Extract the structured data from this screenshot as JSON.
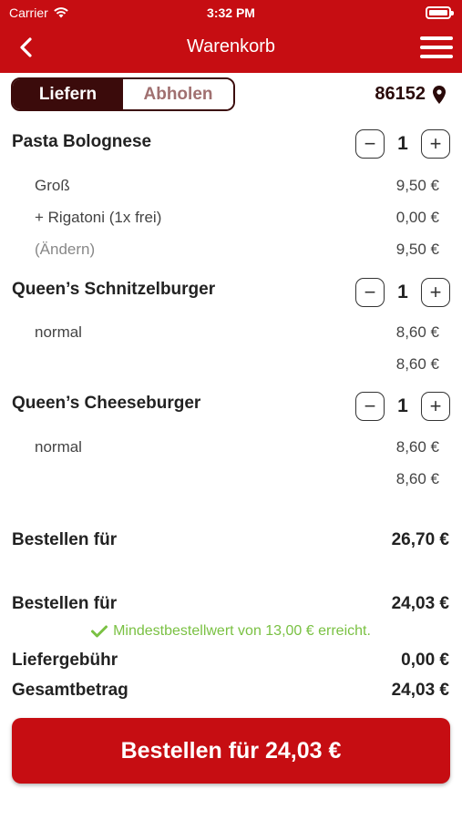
{
  "status_bar": {
    "carrier": "Carrier",
    "time": "3:32 PM"
  },
  "header": {
    "title": "Warenkorb"
  },
  "mode_toggle": {
    "deliver": "Liefern",
    "pickup": "Abholen"
  },
  "location": {
    "zip": "86152"
  },
  "items": [
    {
      "name": "Pasta Bolognese",
      "quantity": "1",
      "lines": [
        {
          "label": "Groß",
          "price": "9,50 €"
        },
        {
          "label": "+ Rigatoni (1x frei)",
          "price": "0,00 €"
        },
        {
          "label": "(Ändern)",
          "price": "9,50 €"
        }
      ]
    },
    {
      "name": "Queen’s Schnitzelburger",
      "quantity": "1",
      "lines": [
        {
          "label": "normal",
          "price": "8,60 €"
        },
        {
          "label": "",
          "price": "8,60 €"
        }
      ]
    },
    {
      "name": "Queen’s Cheeseburger",
      "quantity": "1",
      "lines": [
        {
          "label": "normal",
          "price": "8,60 €"
        },
        {
          "label": "",
          "price": "8,60 €"
        }
      ]
    }
  ],
  "summary": {
    "subtotal_label": "Bestellen für",
    "subtotal_value": "26,70 €",
    "discounted_label": "Bestellen für",
    "discounted_value": "24,03 €",
    "min_order_notice": "Mindestbestellwert von 13,00 € erreicht.",
    "delivery_fee_label": "Liefergebühr",
    "delivery_fee_value": "0,00 €",
    "total_label": "Gesamtbetrag",
    "total_value": "24,03 €"
  },
  "order_button": {
    "label": "Bestellen für 24,03 €"
  },
  "colors": {
    "brand_red": "#c60d12",
    "dark_brown": "#3b0b0b",
    "success_green": "#7ac143"
  }
}
